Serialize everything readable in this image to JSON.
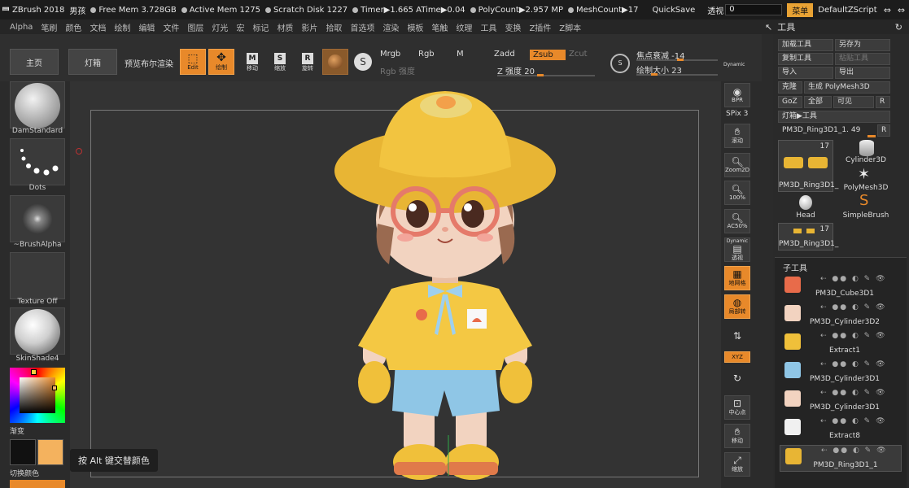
{
  "titlebar": {
    "app": "ZBrush 2018",
    "user": "男孩",
    "free_mem": "Free Mem 3.728GB",
    "active_mem": "Active Mem 1275",
    "scratch": "Scratch Disk 1227",
    "timer": "Timer▶1.665 ATime▶0.04",
    "polycount": "PolyCount▶2.957 MP",
    "meshcount": "MeshCount▶17",
    "quicksave": "QuickSave",
    "persp_label": "透视",
    "persp_value": "0",
    "menu_btn": "菜单",
    "script": "DefaultZScript"
  },
  "menubar": [
    "Alpha",
    "笔刷",
    "颜色",
    "文档",
    "绘制",
    "编辑",
    "文件",
    "图层",
    "灯光",
    "宏",
    "标记",
    "材质",
    "影片",
    "拾取",
    "首选项",
    "渲染",
    "模板",
    "笔触",
    "纹理",
    "工具",
    "变换",
    "Z插件",
    "Z脚本"
  ],
  "rp_head": {
    "title": "工具"
  },
  "toolbar": {
    "home": "主页",
    "lightbox": "灯箱",
    "preview_bool": "预览布尔渲染",
    "edit": "Edit",
    "draw": "绘制",
    "move": "移动",
    "scale": "缩放",
    "rotate": "旋转",
    "mrgb": "Mrgb",
    "rgb": "Rgb",
    "m": "M",
    "zadd": "Zadd",
    "zsub": "Zsub",
    "zcut": "Zcut",
    "rgb_intensity": "Rgb 强度",
    "z_intensity": "Z 强度 20",
    "focal_shift": "焦点衰减 -14",
    "draw_size": "绘制大小 23",
    "dynamic": "Dynamic"
  },
  "leftpanel": {
    "brush": "DamStandard",
    "stroke": "Dots",
    "alpha": "~BrushAlpha",
    "texture": "Texture Off",
    "material": "SkinShade4",
    "gradient": "渐变",
    "switch_color": "切换颜色",
    "colors": {
      "primary": "#111111",
      "secondary": "#f4b25e"
    }
  },
  "canvas": {
    "tooltip": "按 Alt 键交替颜色"
  },
  "vstrip": {
    "bpr": "BPR",
    "spix": "SPix 3",
    "scroll": "滚动",
    "zoom2d": "Zoom2D",
    "p100": "100%",
    "ac50": "AC50%",
    "dynamic": "Dynamic",
    "persp": "透视",
    "floor": "地网格",
    "local": "局部转",
    "xyz": "XYZ",
    "center": "中心点",
    "move": "移动",
    "scale": "缩放"
  },
  "rightpanel": {
    "load": "加载工具",
    "save_as": "另存为",
    "copy": "复制工具",
    "paste": "粘贴工具",
    "import": "导入",
    "export": "导出",
    "clone": "克隆",
    "make_polymesh": "生成 PolyMesh3D",
    "goz": "GoZ",
    "all": "全部",
    "visible": "可见",
    "r": "R",
    "lightbox_tools": "灯箱▶工具",
    "current_tool": "PM3D_Ring3D1_1. 49",
    "thumb_count_1": "17",
    "thumb_name_1": "PM3D_Ring3D1_",
    "thumb_cyl": "Cylinder3D",
    "thumb_poly": "PolyMesh3D",
    "thumb_head": "Head",
    "thumb_simple": "SimpleBrush",
    "thumb_count_2": "17",
    "thumb_name_2": "PM3D_Ring3D1_",
    "subtool_title": "子工具",
    "subtools": [
      "PM3D_Cube3D1",
      "PM3D_Cylinder3D2",
      "Extract1",
      "PM3D_Cylinder3D1",
      "PM3D_Cylinder3D1",
      "Extract8",
      "PM3D_Ring3D1_1"
    ]
  }
}
